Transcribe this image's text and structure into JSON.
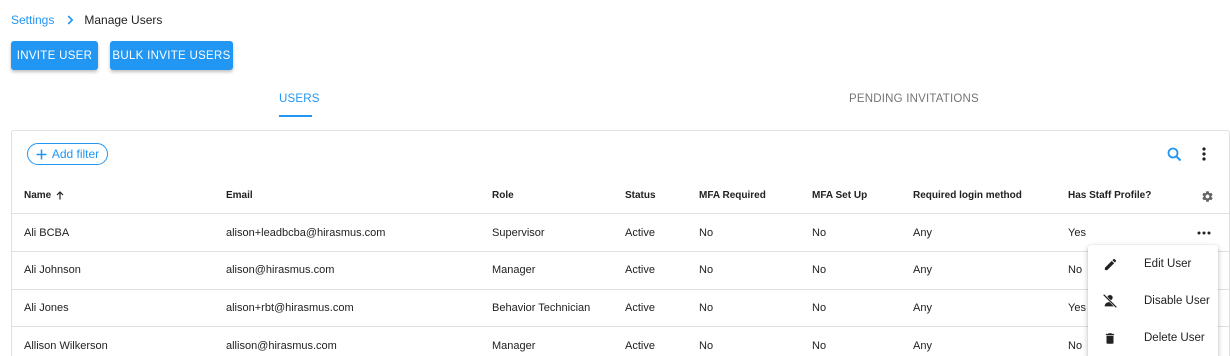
{
  "breadcrumb": {
    "parent": "Settings",
    "current": "Manage Users"
  },
  "actions": {
    "invite_label": "INVITE USER",
    "bulk_invite_label": "BULK INVITE USERS"
  },
  "tabs": [
    {
      "label": "USERS",
      "active": true
    },
    {
      "label": "PENDING INVITATIONS",
      "active": false
    }
  ],
  "toolbar": {
    "add_filter_label": "Add filter",
    "search_icon": "search-icon",
    "more_icon": "more-vert-icon"
  },
  "table": {
    "columns": [
      {
        "key": "name",
        "label": "Name",
        "sorted": "ascending"
      },
      {
        "key": "email",
        "label": "Email"
      },
      {
        "key": "role",
        "label": "Role"
      },
      {
        "key": "status",
        "label": "Status"
      },
      {
        "key": "mfa_required",
        "label": "MFA Required"
      },
      {
        "key": "mfa_set_up",
        "label": "MFA Set Up"
      },
      {
        "key": "login_method",
        "label": "Required login method"
      },
      {
        "key": "staff_profile",
        "label": "Has Staff Profile?"
      }
    ],
    "rows": [
      {
        "name": "Ali BCBA",
        "email": "alison+leadbcba@hirasmus.com",
        "role": "Supervisor",
        "status": "Active",
        "mfa_required": "No",
        "mfa_set_up": "No",
        "login_method": "Any",
        "staff_profile": "Yes"
      },
      {
        "name": "Ali Johnson",
        "email": "alison@hirasmus.com",
        "role": "Manager",
        "status": "Active",
        "mfa_required": "No",
        "mfa_set_up": "No",
        "login_method": "Any",
        "staff_profile": "No"
      },
      {
        "name": "Ali Jones",
        "email": "alison+rbt@hirasmus.com",
        "role": "Behavior Technician",
        "status": "Active",
        "mfa_required": "No",
        "mfa_set_up": "No",
        "login_method": "Any",
        "staff_profile": "Yes"
      },
      {
        "name": "Allison Wilkerson",
        "email": "allison@hirasmus.com",
        "role": "Manager",
        "status": "Active",
        "mfa_required": "No",
        "mfa_set_up": "No",
        "login_method": "Any",
        "staff_profile": "No"
      }
    ]
  },
  "row_menu": {
    "items": [
      {
        "label": "Edit User",
        "icon": "edit-icon"
      },
      {
        "label": "Disable User",
        "icon": "person-off-icon"
      },
      {
        "label": "Delete User",
        "icon": "trash-icon"
      }
    ]
  },
  "colors": {
    "accent": "#2196f3",
    "text": "#212121",
    "muted": "#757575",
    "border": "#e0e0e0"
  }
}
